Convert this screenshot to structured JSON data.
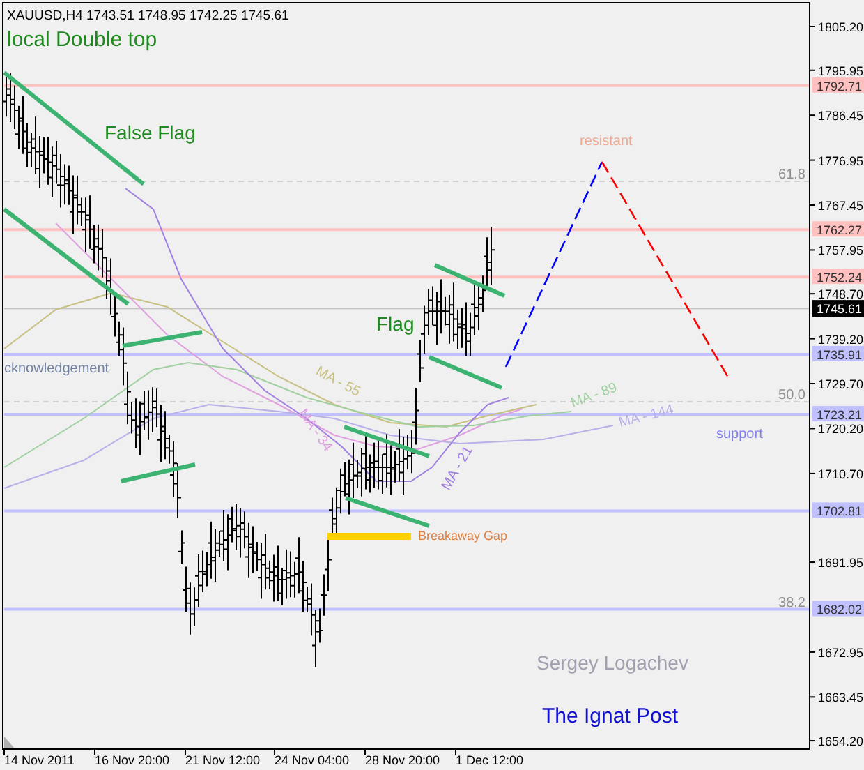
{
  "chart_header": {
    "quote": "XAUUSD,H4  1743.51 1748.95 1742.25 1745.61"
  },
  "annotations": [
    {
      "kind": "note",
      "text": "local Double top",
      "color": "#1f8a1f"
    },
    {
      "kind": "note",
      "text": "False Flag",
      "color": "#1f8a1f"
    },
    {
      "kind": "note",
      "text": "Flag",
      "color": "#1f8a1f"
    },
    {
      "kind": "note",
      "text": "cknowledgement",
      "color": "#7080a0"
    },
    {
      "kind": "note",
      "text": "resistant",
      "color": "#f0a890"
    },
    {
      "kind": "note",
      "text": "support",
      "color": "#8080f0"
    },
    {
      "kind": "note",
      "text": "Breakaway Gap",
      "color": "#e08040"
    },
    {
      "kind": "ma",
      "text": "MA - 55",
      "color": "#c8c080"
    },
    {
      "kind": "ma",
      "text": "MA - 34",
      "color": "#e0a0e0"
    },
    {
      "kind": "ma",
      "text": "MA - 89",
      "color": "#a0d0a0"
    },
    {
      "kind": "ma",
      "text": "MA - 144",
      "color": "#b8b0e8"
    },
    {
      "kind": "ma",
      "text": "MA - 21",
      "color": "#a080e0"
    },
    {
      "kind": "signature",
      "text": "Sergey Logachev",
      "color": "#a0a0b0"
    },
    {
      "kind": "signature",
      "text": "The Ignat Post",
      "color": "#1010d0"
    }
  ],
  "fib_levels": [
    {
      "label": "61.8"
    },
    {
      "label": "50.0"
    },
    {
      "label": "38.2"
    }
  ],
  "levels": [
    {
      "label": "1792.71",
      "color": "#ffc0c0"
    },
    {
      "label": "1762.27",
      "color": "#ffc0c0"
    },
    {
      "label": "1752.24",
      "color": "#ffc0c0"
    },
    {
      "label": "1735.91",
      "color": "#c0c0ff"
    },
    {
      "label": "1723.21",
      "color": "#c0c0ff"
    },
    {
      "label": "1702.81",
      "color": "#c0c0ff"
    },
    {
      "label": "1682.02",
      "color": "#c0c0ff"
    }
  ],
  "current_price": "1745.61",
  "price_axis": {
    "ticks": [
      "1805.20",
      "1795.95",
      "1786.45",
      "1776.95",
      "1767.45",
      "1757.95",
      "1748.70",
      "1739.20",
      "1729.70",
      "1720.20",
      "1710.70",
      "1691.95",
      "1672.95",
      "1663.45",
      "1654.20"
    ]
  },
  "time_axis": {
    "ticks": [
      "14 Nov 2011",
      "16 Nov 20:00",
      "21 Nov 12:00",
      "24 Nov 04:00",
      "28 Nov 20:00",
      "1 Dec 12:00"
    ]
  }
}
